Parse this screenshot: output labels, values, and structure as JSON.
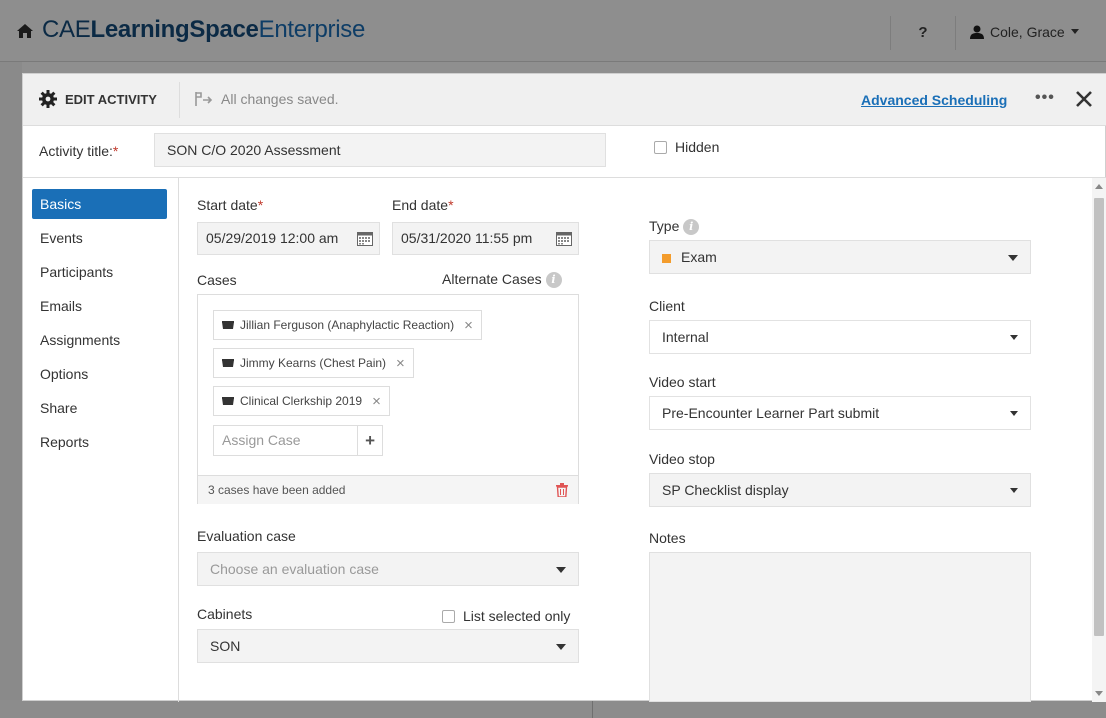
{
  "app": {
    "brand_prefix": "CAE",
    "brand_main": "LearningSpace",
    "brand_suffix": "Enterprise",
    "help": "?",
    "user": "Cole, Grace"
  },
  "modal": {
    "title": "EDIT ACTIVITY",
    "saved_status": "All changes saved.",
    "advanced_link": "Advanced Scheduling",
    "more": "•••",
    "activity_title_label": "Activity title:",
    "required_mark": "*",
    "activity_title_value": "SON C/O 2020 Assessment",
    "hidden_label": "Hidden"
  },
  "sidebar": {
    "items": [
      {
        "label": "Basics",
        "active": true
      },
      {
        "label": "Events"
      },
      {
        "label": "Participants"
      },
      {
        "label": "Emails"
      },
      {
        "label": "Assignments"
      },
      {
        "label": "Options"
      },
      {
        "label": "Share"
      },
      {
        "label": "Reports"
      }
    ]
  },
  "basics": {
    "start_date_label": "Start date",
    "start_date_value": "05/29/2019 12:00 am",
    "end_date_label": "End date",
    "end_date_value": "05/31/2020 11:55 pm",
    "cases_label": "Cases",
    "alternate_cases_label": "Alternate Cases",
    "cases": [
      "Jillian Ferguson (Anaphylactic Reaction)",
      "Jimmy Kearns (Chest Pain)",
      "Clinical Clerkship 2019"
    ],
    "assign_case_placeholder": "Assign Case",
    "cases_footer": "3 cases have been added",
    "evaluation_case_label": "Evaluation case",
    "evaluation_case_placeholder": "Choose an evaluation case",
    "cabinets_label": "Cabinets",
    "list_selected_label": "List selected only",
    "cabinets_value": "SON",
    "type_label": "Type",
    "type_value": "Exam",
    "type_color": "#f39c2c",
    "client_label": "Client",
    "client_value": "Internal",
    "video_start_label": "Video start",
    "video_start_value": "Pre-Encounter Learner Part submit",
    "video_stop_label": "Video stop",
    "video_stop_value": "SP Checklist display",
    "notes_label": "Notes",
    "notes_value": ""
  },
  "colors": {
    "accent": "#1a6fb7",
    "required": "#c0392b"
  }
}
